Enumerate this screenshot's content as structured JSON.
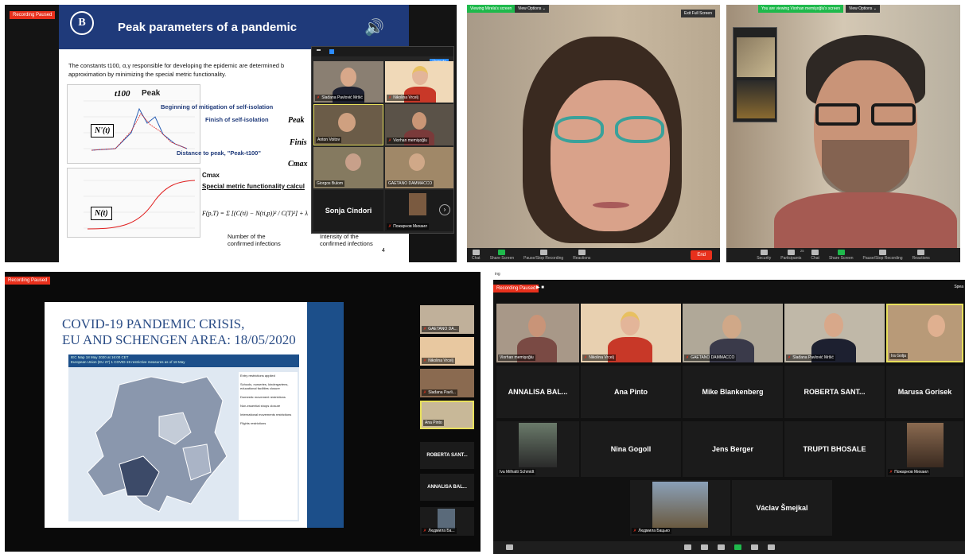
{
  "panel1": {
    "rec": "Recording Paused",
    "slide_title": "Peak parameters of a pandemic",
    "intro": "The constants t100, α,γ responsible for developing the epidemic are determined b",
    "intro2": "approximation by minimizing the special metric functionality.",
    "t100": "t100",
    "peak": "Peak",
    "begin": "Beginning of mitigation of self-isolation",
    "finish": "Finish of self-isolation",
    "distance": "Distance to peak, \"Peak-t100\"",
    "nt": "N'(t)",
    "nt2": "N(t)",
    "cmax": "Cmax",
    "special": "Special metric functionality calcul",
    "peak_r": "Peak",
    "finis_r": "Finis",
    "cmax_r": "Cmax",
    "formula": "F(p,T) = Σ [(C(ti) − N(ti,p))² / C(T)²] + λ",
    "num_conf": "Number of the",
    "num_conf2": "confirmed infections",
    "intens": "Intensity of the",
    "intens2": "confirmed infections",
    "pageno": "4",
    "unmute": "Unmute",
    "thumbs": [
      {
        "name": "Slađana Pavlović Mršić"
      },
      {
        "name": "Nikolina Vrcelj"
      },
      {
        "name": "Anton Voitov"
      },
      {
        "name": "Viorhan memişoğlu"
      },
      {
        "name": "Giorgos Bulom"
      },
      {
        "name": "GAETANO DAMMACCO"
      },
      {
        "name": "Sonja Cindori"
      },
      {
        "name": "Пожарнов Михаил"
      }
    ]
  },
  "panel2": {
    "viewing": "Viewing Mirela's screen",
    "options": "View Options ⌄",
    "exit": "Exit Full Screen",
    "toolbar": [
      "Chat",
      "Share Screen",
      "Pause/Stop Recording",
      "Reactions"
    ],
    "end": "End"
  },
  "panel3": {
    "viewing": "You are viewing Viorhan memişoğlu's screen",
    "options": "View Options ⌄",
    "toolbar": [
      "Security",
      "Participants",
      "Chat",
      "Share Screen",
      "Pause/Stop Recording",
      "Reactions"
    ],
    "participants_count": "25"
  },
  "panel4": {
    "rec": "Recording Paused",
    "title1": "COVID-19 PANDEMIC CRISIS,",
    "title2": "EU AND SCHENGEN AREA: 18/05/2020",
    "map_header1": "IEC Map 18 May 2020 at 16:00 CET",
    "map_header2": "European Union (EU 27) 1 COVID-19 restrictive measures as of 18 May",
    "legend": [
      "Entry restrictions applied",
      "Schools, nurseries, kindergartens, educational facilities closure",
      "Domestic movement restrictions",
      "Non-essential shops closure",
      "International movements restrictions",
      "Flights restrictions"
    ],
    "side": [
      {
        "name": "GAETANO DA..."
      },
      {
        "name": "Nikolina Vrcelj"
      },
      {
        "name": "Slađana Pavli..."
      },
      {
        "name": "Ana Pinto"
      },
      {
        "name": "ROBERTA SANT..."
      },
      {
        "name": "ANNALISA BAL..."
      },
      {
        "name": "Людмила Ба..."
      }
    ]
  },
  "panel5": {
    "title": "ing",
    "rec": "Recording Paused",
    "speaker": "Spea",
    "row1": [
      "Viorhan memişoğlu",
      "Nikolina Vrcelj",
      "GAETANO DAMMACCO",
      "Slađana Pavlović Mršić",
      "Ira Golja"
    ],
    "row2": [
      "ANNALISA BAL...",
      "Ana Pinto",
      "Mike Blankenberg",
      "ROBERTA SANT...",
      "Marusa Gorisek"
    ],
    "row3": [
      "Iva Milhatti Schmidt",
      "Nina Gogoll",
      "Jens Berger",
      "TRUPTI BHOSALE",
      "Пожарнов Михаил"
    ],
    "row4": [
      "Людмила Бацько",
      "Václav Šmejkal"
    ],
    "participants_count": "17"
  }
}
